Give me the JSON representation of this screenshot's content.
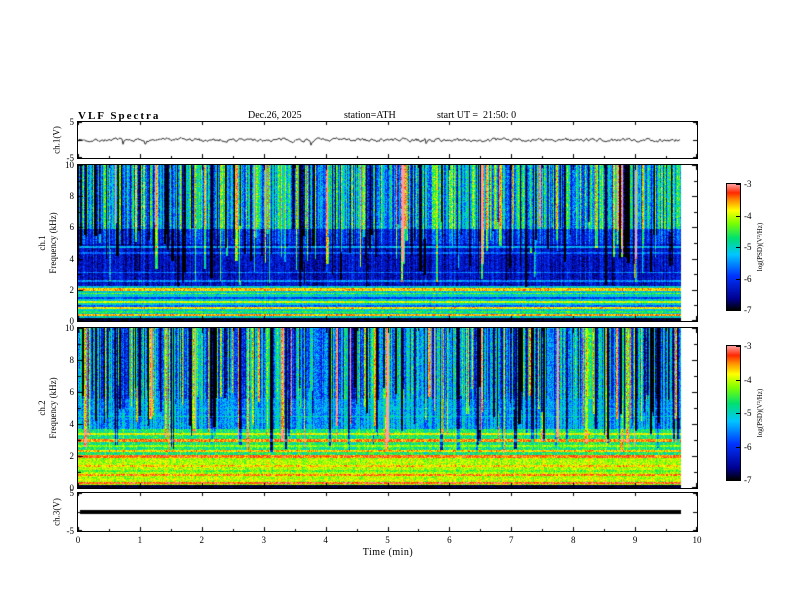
{
  "header": {
    "title": "VLF Spectra",
    "date": "Dec.26, 2025",
    "station": "station=ATH",
    "start_ut": "start UT =  21:50: 0"
  },
  "xaxis": {
    "label": "Time (min)",
    "ticks": [
      0,
      1,
      2,
      3,
      4,
      5,
      6,
      7,
      8,
      9,
      10
    ],
    "range": [
      0,
      10
    ]
  },
  "panels": {
    "wave1": {
      "ylabel": "ch.1(V)",
      "yticks": [
        5,
        -5
      ],
      "ylim": [
        -5,
        5
      ]
    },
    "spec1": {
      "ylabel": "ch.1\nFrequency (kHz)",
      "yticks": [
        10,
        8,
        6,
        4,
        2,
        0
      ],
      "ylim": [
        0,
        10
      ]
    },
    "spec2": {
      "ylabel": "ch.2\nFrequency (kHz)",
      "yticks": [
        10,
        8,
        6,
        4,
        2,
        0
      ],
      "ylim": [
        0,
        10
      ]
    },
    "wave3": {
      "ylabel": "ch.3(V)",
      "yticks": [
        5,
        -5
      ],
      "ylim": [
        -5,
        5
      ]
    }
  },
  "colorbar": {
    "label": "log(PSD)(V²/Hz)",
    "ticks": [
      -3,
      -4,
      -5,
      -6,
      -7
    ],
    "stops": [
      [
        0,
        "#000000"
      ],
      [
        0.09,
        "#000090"
      ],
      [
        0.27,
        "#0034ff"
      ],
      [
        0.44,
        "#00c6ff"
      ],
      [
        0.57,
        "#00e070"
      ],
      [
        0.69,
        "#7dff00"
      ],
      [
        0.79,
        "#ffff00"
      ],
      [
        0.87,
        "#ff9000"
      ],
      [
        0.93,
        "#ff2800"
      ],
      [
        1,
        "#ffa0a0"
      ]
    ]
  },
  "chart_data": [
    {
      "type": "line",
      "panel": "wave1",
      "name": "ch.1 voltage waveform",
      "xrange_min": [
        0,
        9.75
      ],
      "ylim": [
        -5,
        5
      ],
      "mean": 0,
      "noise_amplitude": 0.9,
      "spike_amplitude": 2.6,
      "seed": 7,
      "description": "continuous thin black noise trace fluctuating near 0 V"
    },
    {
      "type": "heatmap",
      "panel": "spec1",
      "name": "ch.1 VLF spectrogram",
      "xrange_min": [
        0,
        9.75
      ],
      "flim_khz": [
        0,
        10
      ],
      "vlim": [
        -7,
        -3
      ],
      "seed": 21,
      "streaks": 180,
      "bands": [
        {
          "f0": 0.0,
          "f1": 0.25,
          "base": -6.9,
          "col": 0.05,
          "pix": 0.15
        },
        {
          "f0": 0.25,
          "f1": 2.3,
          "base": -5.1,
          "col": 0.15,
          "pix": 0.45
        },
        {
          "f0": 2.3,
          "f1": 5.0,
          "base": -6.35,
          "col": 0.35,
          "pix": 0.35
        },
        {
          "f0": 5.0,
          "f1": 5.9,
          "base": -6.0,
          "col": 0.55,
          "pix": 0.4
        },
        {
          "f0": 5.9,
          "f1": 10.0,
          "base": -5.15,
          "col": 0.95,
          "pix": 0.5
        }
      ],
      "hlines": [
        {
          "f": 4.75,
          "v": -5.35,
          "wd": 0.06
        },
        {
          "f": 4.4,
          "v": -5.7,
          "wd": 0.05
        },
        {
          "f": 3.15,
          "v": -5.6,
          "wd": 0.05
        },
        {
          "f": 2.6,
          "v": -5.5,
          "wd": 0.04
        },
        {
          "f": 2.05,
          "v": -3.7,
          "wd": 0.07
        },
        {
          "f": 1.8,
          "v": -4.4,
          "wd": 0.05
        },
        {
          "f": 1.5,
          "v": -5.9,
          "wd": 0.08
        },
        {
          "f": 1.25,
          "v": -4.0,
          "wd": 0.06
        },
        {
          "f": 1.0,
          "v": -5.7,
          "wd": 0.06
        },
        {
          "f": 0.85,
          "v": -3.8,
          "wd": 0.06
        },
        {
          "f": 0.6,
          "v": -4.6,
          "wd": 0.05
        },
        {
          "f": 0.42,
          "v": -3.6,
          "wd": 0.06
        }
      ],
      "description": "dense vertical sferic streaks above ~6 kHz over green/cyan, dark blue band 2.5-6 kHz with faint cyan lines, colored horizontal harmonic stripes below 2.3 kHz, black band at 0"
    },
    {
      "type": "heatmap",
      "panel": "spec2",
      "name": "ch.2 VLF spectrogram",
      "xrange_min": [
        0,
        9.75
      ],
      "flim_khz": [
        0,
        10
      ],
      "vlim": [
        -7,
        -3
      ],
      "seed": 42,
      "streaks": 180,
      "bands": [
        {
          "f0": 0.0,
          "f1": 0.25,
          "base": -6.9,
          "col": 0.05,
          "pix": 0.15
        },
        {
          "f0": 0.25,
          "f1": 2.1,
          "base": -4.1,
          "col": 0.15,
          "pix": 0.4
        },
        {
          "f0": 2.1,
          "f1": 3.7,
          "base": -4.7,
          "col": 0.25,
          "pix": 0.45
        },
        {
          "f0": 3.7,
          "f1": 5.6,
          "base": -5.4,
          "col": 0.5,
          "pix": 0.45
        },
        {
          "f0": 5.6,
          "f1": 10.0,
          "base": -5.5,
          "col": 1.05,
          "pix": 0.5
        }
      ],
      "hlines": [
        {
          "f": 5.0,
          "v": -5.2,
          "wd": 0.04
        },
        {
          "f": 4.5,
          "v": -5.0,
          "wd": 0.05
        },
        {
          "f": 3.4,
          "v": -3.9,
          "wd": 0.08
        },
        {
          "f": 3.0,
          "v": -3.5,
          "wd": 0.08
        },
        {
          "f": 2.65,
          "v": -4.2,
          "wd": 0.06
        },
        {
          "f": 2.35,
          "v": -3.7,
          "wd": 0.06
        },
        {
          "f": 2.0,
          "v": -3.4,
          "wd": 0.08
        },
        {
          "f": 1.7,
          "v": -4.1,
          "wd": 0.06
        },
        {
          "f": 1.4,
          "v": -3.7,
          "wd": 0.07
        },
        {
          "f": 1.1,
          "v": -4.4,
          "wd": 0.05
        },
        {
          "f": 0.85,
          "v": -3.5,
          "wd": 0.07
        },
        {
          "f": 0.55,
          "v": -4.0,
          "wd": 0.06
        },
        {
          "f": 0.35,
          "v": -3.3,
          "wd": 0.06
        }
      ],
      "description": "vertical sferic streaks above ~5.5 kHz over cyan/blue, green 4-5.5 kHz, strong yellow/red horizontal harmonic bands 0.3-3.5 kHz, black band at 0"
    },
    {
      "type": "line",
      "panel": "wave3",
      "name": "ch.3 voltage (flat)",
      "xrange_min": [
        0,
        9.75
      ],
      "ylim": [
        -5,
        5
      ],
      "constant": 0,
      "line_width": 4,
      "description": "flat thick black line at ~0 V"
    }
  ]
}
